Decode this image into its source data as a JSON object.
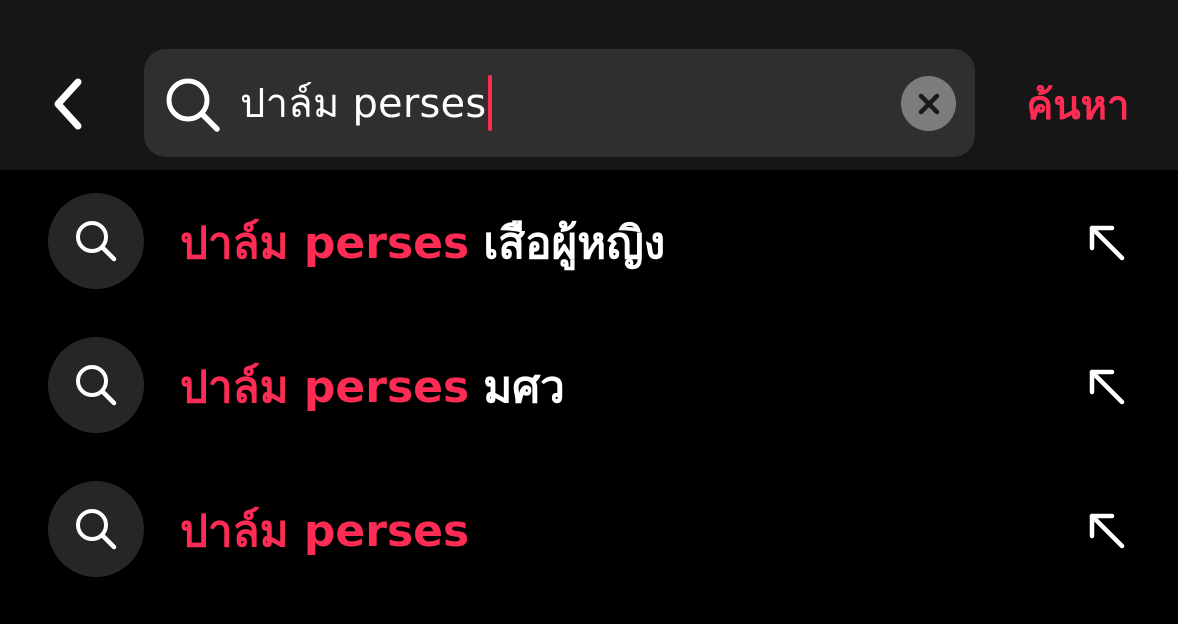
{
  "colors": {
    "accent": "#fe2c55",
    "header_bg": "#161616",
    "search_box_bg": "#2f2f2f",
    "page_bg": "#000000",
    "text": "#ffffff"
  },
  "header": {
    "back_icon": "chevron-left-icon",
    "search": {
      "value": "ปาล์ม perses",
      "icon": "search-icon",
      "clear_icon": "close-icon"
    },
    "submit_label": "ค้นหา"
  },
  "suggestions": [
    {
      "highlight": "ปาล์ม perses",
      "rest": "เสือผู้หญิง",
      "icon": "search-icon",
      "action_icon": "arrow-up-left-icon"
    },
    {
      "highlight": "ปาล์ม perses",
      "rest": "มศว",
      "icon": "search-icon",
      "action_icon": "arrow-up-left-icon"
    },
    {
      "highlight": "ปาล์ม perses",
      "rest": "",
      "icon": "search-icon",
      "action_icon": "arrow-up-left-icon"
    }
  ]
}
